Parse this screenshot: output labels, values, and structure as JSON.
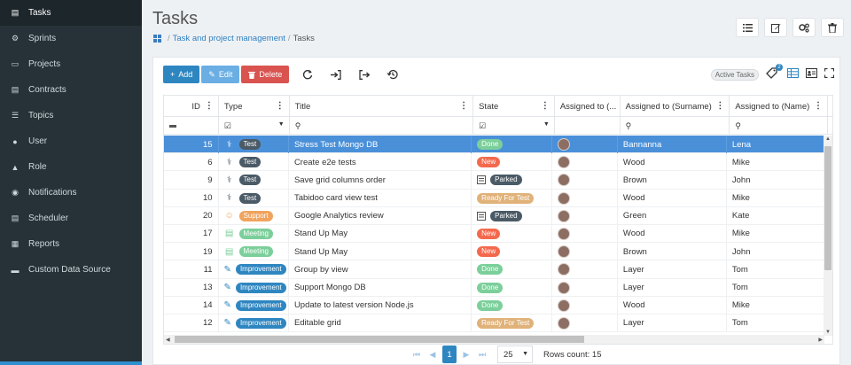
{
  "sidebar": {
    "items": [
      {
        "label": "Tasks",
        "icon": "document-icon",
        "active": true
      },
      {
        "label": "Sprints",
        "icon": "sprint-icon"
      },
      {
        "label": "Projects",
        "icon": "projects-icon"
      },
      {
        "label": "Contracts",
        "icon": "contracts-icon"
      },
      {
        "label": "Topics",
        "icon": "topics-icon"
      },
      {
        "label": "User",
        "icon": "user-icon"
      },
      {
        "label": "Role",
        "icon": "role-icon"
      },
      {
        "label": "Notifications",
        "icon": "eye-icon"
      },
      {
        "label": "Scheduler",
        "icon": "scheduler-icon"
      },
      {
        "label": "Reports",
        "icon": "reports-icon"
      },
      {
        "label": "Custom Data Source",
        "icon": "database-icon"
      }
    ]
  },
  "header": {
    "title": "Tasks",
    "breadcrumb": {
      "link": "Task and project management",
      "current": "Tasks",
      "sep": "/"
    }
  },
  "toolbar": {
    "add_label": "Add",
    "edit_label": "Edit",
    "delete_label": "Delete",
    "active_tasks_label": "Active Tasks",
    "active_tasks_count": "2"
  },
  "grid": {
    "columns": [
      "ID",
      "Type",
      "Title",
      "State",
      "Assigned to (...",
      "Assigned to (Surname)",
      "Assigned to (Name)"
    ],
    "rows": [
      {
        "id": "15",
        "type": "Test",
        "title": "Stress Test Mongo DB",
        "state": "Done",
        "surname": "Bannanna",
        "name": "Lena",
        "selected": true
      },
      {
        "id": "6",
        "type": "Test",
        "title": "Create e2e tests",
        "state": "New",
        "surname": "Wood",
        "name": "Mike"
      },
      {
        "id": "9",
        "type": "Test",
        "title": "Save grid columns order",
        "state": "Parked",
        "surname": "Brown",
        "name": "John"
      },
      {
        "id": "10",
        "type": "Test",
        "title": "Tabidoo card view test",
        "state": "Ready For Test",
        "surname": "Wood",
        "name": "Mike"
      },
      {
        "id": "20",
        "type": "Support",
        "title": "Google Analytics review",
        "state": "Parked",
        "surname": "Green",
        "name": "Kate"
      },
      {
        "id": "17",
        "type": "Meeting",
        "title": "Stand Up May",
        "state": "New",
        "surname": "Wood",
        "name": "Mike"
      },
      {
        "id": "19",
        "type": "Meeting",
        "title": "Stand Up May",
        "state": "New",
        "surname": "Brown",
        "name": "John"
      },
      {
        "id": "11",
        "type": "Improvement",
        "title": "Group by view",
        "state": "Done",
        "surname": "Layer",
        "name": "Tom"
      },
      {
        "id": "13",
        "type": "Improvement",
        "title": "Support Mongo DB",
        "state": "Done",
        "surname": "Layer",
        "name": "Tom"
      },
      {
        "id": "14",
        "type": "Improvement",
        "title": "Update to latest version Node.js",
        "state": "Done",
        "surname": "Wood",
        "name": "Mike"
      },
      {
        "id": "12",
        "type": "Improvement",
        "title": "Editable grid",
        "state": "Ready For Test",
        "surname": "Layer",
        "name": "Tom"
      }
    ]
  },
  "pager": {
    "current_page": "1",
    "page_size": "25",
    "rows_count": "Rows count: 15"
  },
  "colors": {
    "sidebar_bg": "#263238",
    "accent": "#2e86c1",
    "selected_row": "#4a90d9",
    "type_Test": "#4a5a66",
    "type_Support": "#f0a35e",
    "type_Meeting": "#7bcf9a",
    "type_Improvement": "#2e86c1",
    "state_Done": "#7bcf9a",
    "state_New": "#f4694d",
    "state_Parked": "#4a5a66",
    "state_Ready For Test": "#e0b27a"
  }
}
